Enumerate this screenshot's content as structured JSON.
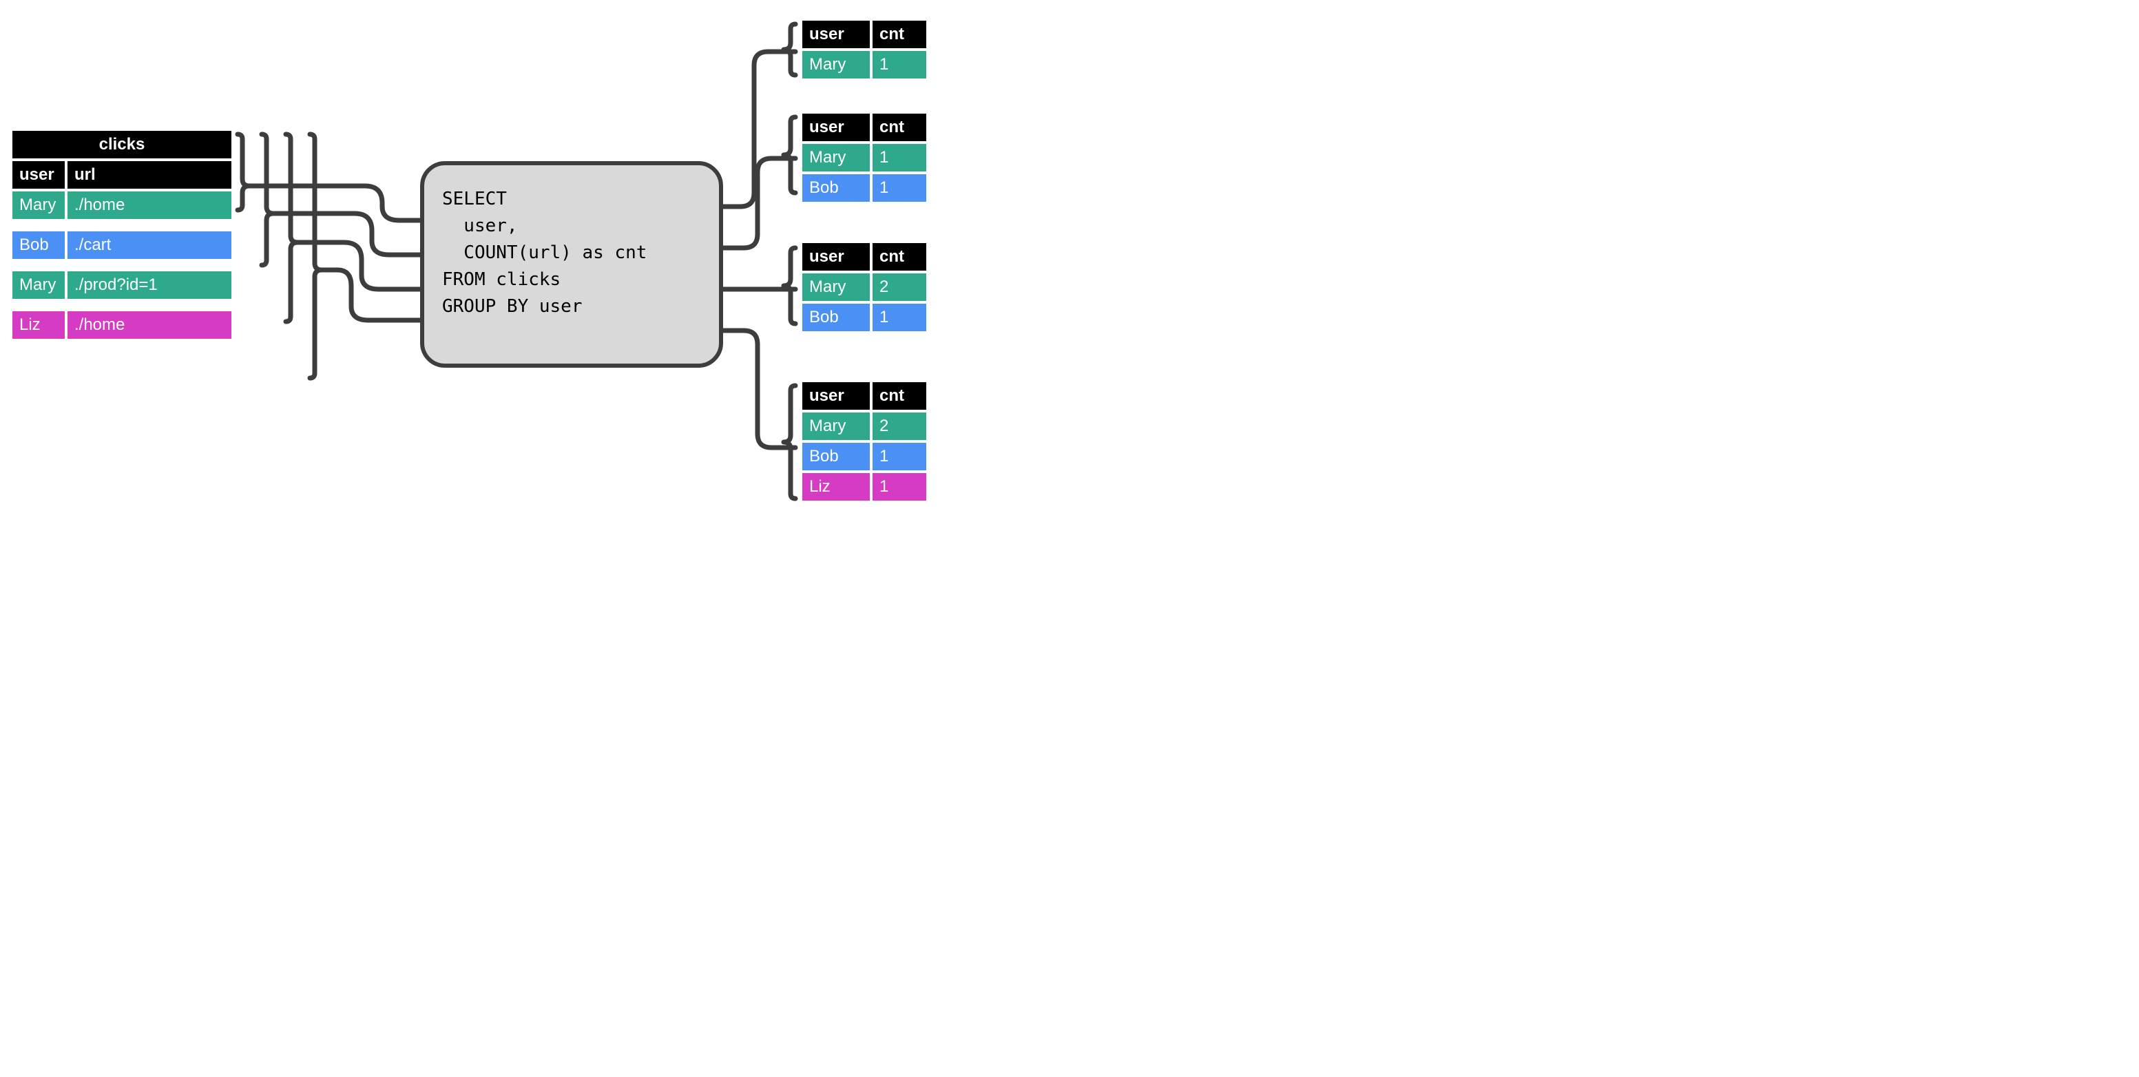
{
  "colors": {
    "teal": "#2fa98c",
    "blue": "#4a90f5",
    "pink": "#d63bc4",
    "black": "#000000",
    "stroke": "#3d3d3d",
    "box_bg": "#d9d9d9"
  },
  "input_table": {
    "title": "clicks",
    "headers": {
      "c1": "user",
      "c2": "url"
    },
    "rows": [
      {
        "user": "Mary",
        "url": "./home",
        "color": "teal"
      },
      {
        "user": "Bob",
        "url": "./cart",
        "color": "blue"
      },
      {
        "user": "Mary",
        "url": "./prod?id=1",
        "color": "teal"
      },
      {
        "user": "Liz",
        "url": "./home",
        "color": "pink"
      }
    ]
  },
  "sql": "SELECT\n  user,\n  COUNT(url) as cnt\nFROM clicks\nGROUP BY user",
  "output_snapshots": [
    {
      "headers": {
        "c1": "user",
        "c2": "cnt"
      },
      "rows": [
        {
          "user": "Mary",
          "cnt": "1",
          "color": "teal",
          "bold": true
        }
      ]
    },
    {
      "headers": {
        "c1": "user",
        "c2": "cnt"
      },
      "rows": [
        {
          "user": "Mary",
          "cnt": "1",
          "color": "teal",
          "bold": false
        },
        {
          "user": "Bob",
          "cnt": "1",
          "color": "blue",
          "bold": true
        }
      ]
    },
    {
      "headers": {
        "c1": "user",
        "c2": "cnt"
      },
      "rows": [
        {
          "user": "Mary",
          "cnt": "2",
          "color": "teal",
          "bold": true
        },
        {
          "user": "Bob",
          "cnt": "1",
          "color": "blue",
          "bold": false
        }
      ]
    },
    {
      "headers": {
        "c1": "user",
        "c2": "cnt"
      },
      "rows": [
        {
          "user": "Mary",
          "cnt": "2",
          "color": "teal",
          "bold": false
        },
        {
          "user": "Bob",
          "cnt": "1",
          "color": "blue",
          "bold": false
        },
        {
          "user": "Liz",
          "cnt": "1",
          "color": "pink",
          "bold": true
        }
      ]
    }
  ]
}
